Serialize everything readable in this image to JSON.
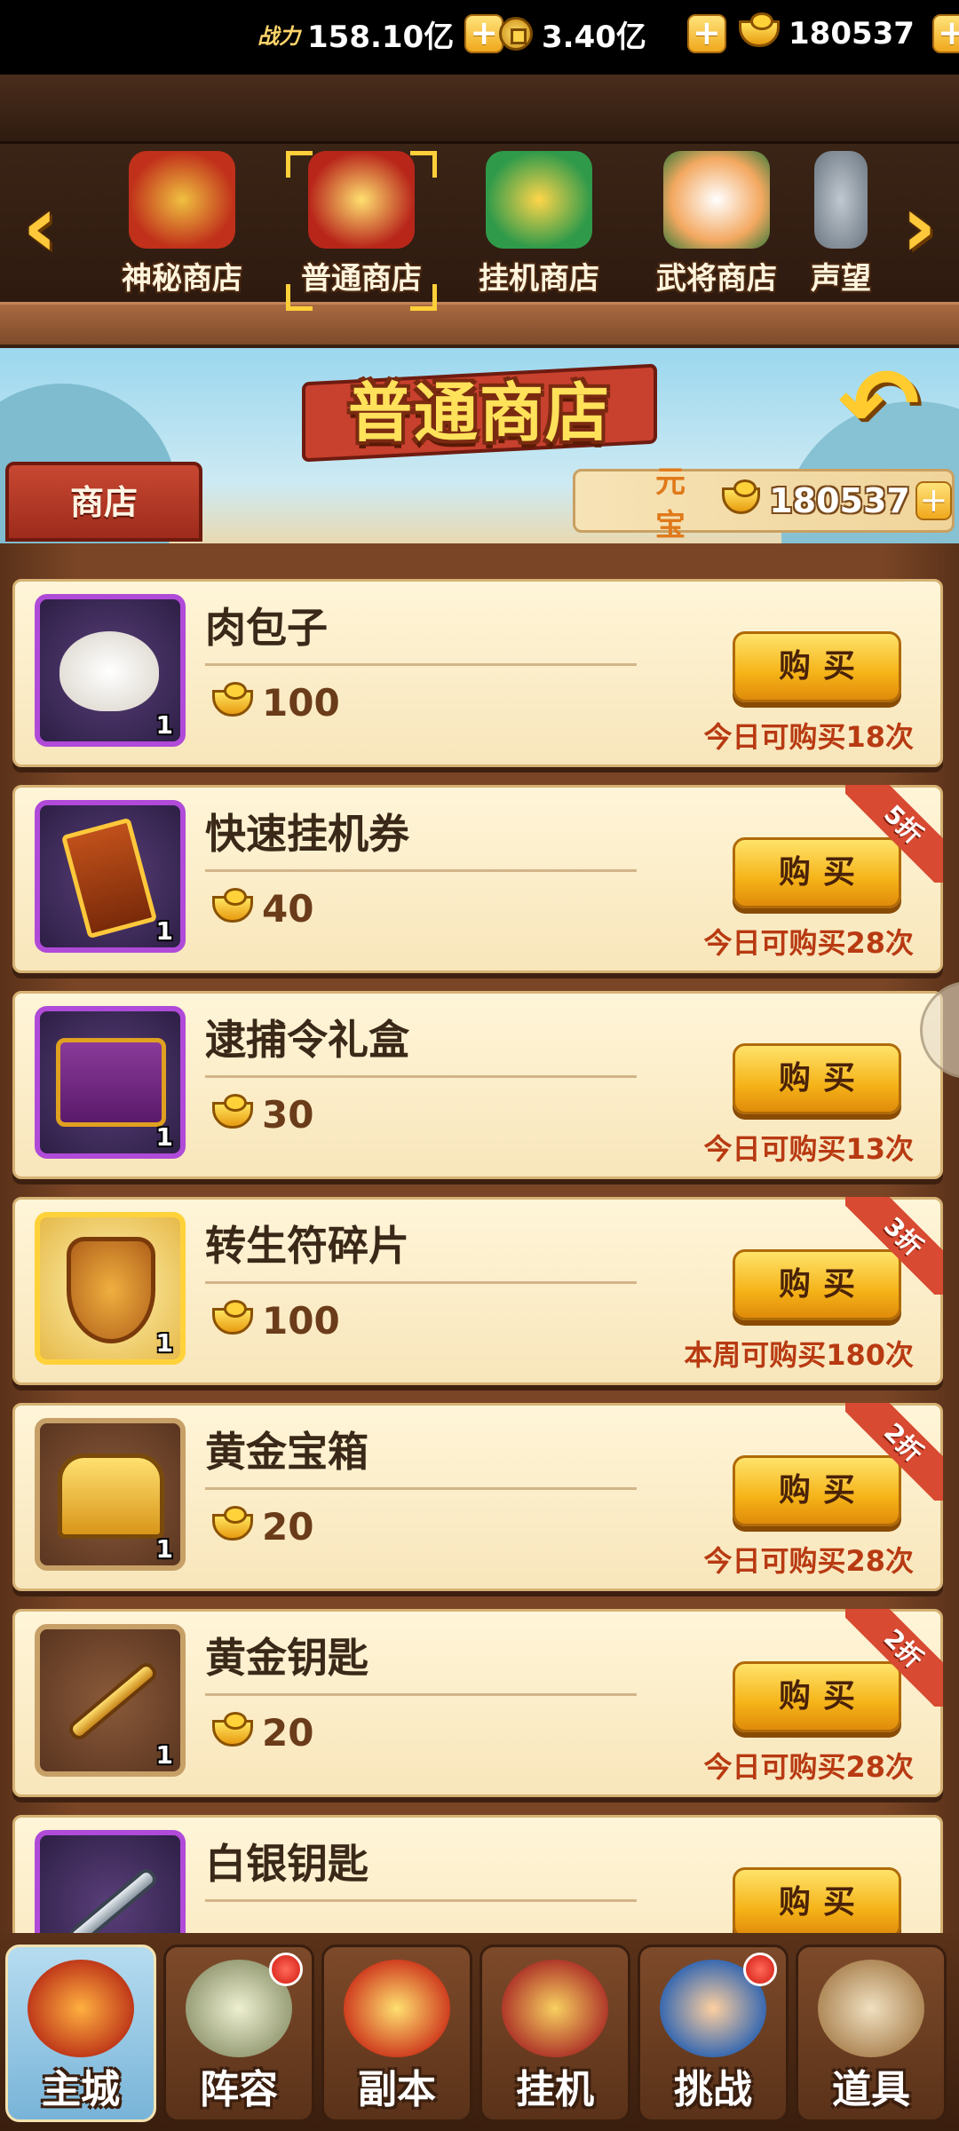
{
  "resources": {
    "power_label": "战力",
    "power_value": "158.10亿",
    "coins_value": "3.40亿",
    "yuanbao_value": "180537"
  },
  "shop_tabs": [
    {
      "label": "神秘商店",
      "selected": false
    },
    {
      "label": "普通商店",
      "selected": true
    },
    {
      "label": "挂机商店",
      "selected": false
    },
    {
      "label": "武将商店",
      "selected": false
    },
    {
      "label": "声望",
      "selected": false
    }
  ],
  "header": {
    "title": "普通商店",
    "shop_label": "商店",
    "currency_label": "元宝",
    "currency_value": "180537"
  },
  "items": [
    {
      "name": "肉包子",
      "price": "100",
      "qty": "1",
      "buy_label": "购买",
      "limit": "今日可购买18次",
      "discount": ""
    },
    {
      "name": "快速挂机券",
      "price": "40",
      "qty": "1",
      "buy_label": "购买",
      "limit": "今日可购买28次",
      "discount": "5折"
    },
    {
      "name": "逮捕令礼盒",
      "price": "30",
      "qty": "1",
      "buy_label": "购买",
      "limit": "今日可购买13次",
      "discount": ""
    },
    {
      "name": "转生符碎片",
      "price": "100",
      "qty": "1",
      "buy_label": "购买",
      "limit": "本周可购买180次",
      "discount": "3折"
    },
    {
      "name": "黄金宝箱",
      "price": "20",
      "qty": "1",
      "buy_label": "购买",
      "limit": "今日可购买28次",
      "discount": "2折"
    },
    {
      "name": "黄金钥匙",
      "price": "20",
      "qty": "1",
      "buy_label": "购买",
      "limit": "今日可购买28次",
      "discount": "2折"
    },
    {
      "name": "白银钥匙",
      "price": "",
      "qty": "",
      "buy_label": "购买",
      "limit": "",
      "discount": ""
    }
  ],
  "nav": [
    {
      "label": "主城",
      "active": true,
      "badge": false
    },
    {
      "label": "阵容",
      "active": false,
      "badge": true
    },
    {
      "label": "副本",
      "active": false,
      "badge": false
    },
    {
      "label": "挂机",
      "active": false,
      "badge": false
    },
    {
      "label": "挑战",
      "active": false,
      "badge": true
    },
    {
      "label": "道具",
      "active": false,
      "badge": false
    }
  ],
  "colors": {
    "accent_gold": "#ffcb2e",
    "ribbon_red": "#c8402e",
    "panel_cream": "#fff5d8",
    "wood_brown": "#7a4526",
    "limit_red": "#b83a12"
  }
}
